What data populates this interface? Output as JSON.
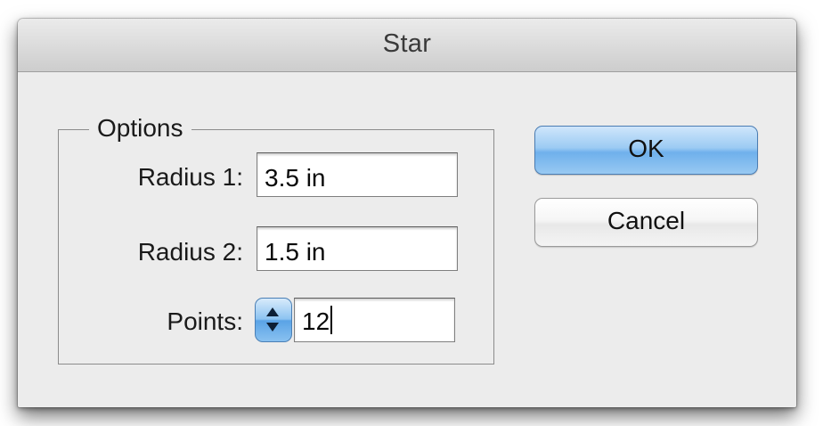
{
  "dialog": {
    "title": "Star"
  },
  "options": {
    "legend": "Options",
    "radius1": {
      "label": "Radius 1:",
      "value": "3.5 in"
    },
    "radius2": {
      "label": "Radius 2:",
      "value": "1.5 in"
    },
    "points": {
      "label": "Points:",
      "value": "12"
    }
  },
  "buttons": {
    "ok": "OK",
    "cancel": "Cancel"
  },
  "colors": {
    "dialog_bg": "#ececec",
    "accent_blue": "#6fb0ec"
  },
  "icons": {
    "stepper": "stepper-arrows-icon"
  }
}
